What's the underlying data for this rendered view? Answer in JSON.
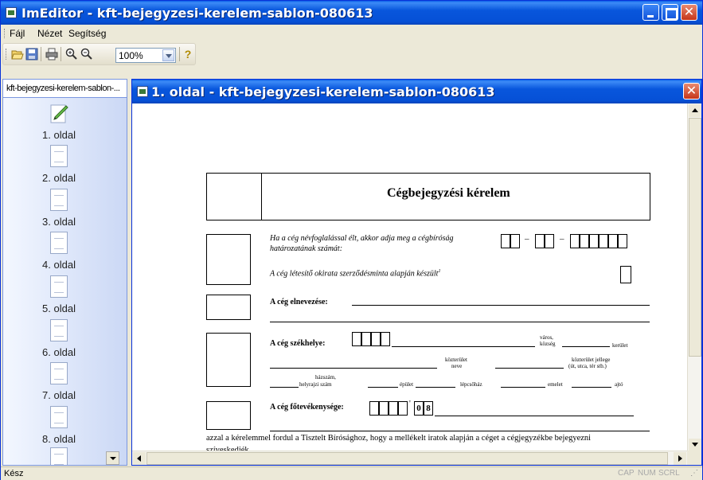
{
  "app": {
    "title": "ImEditor - kft-bejegyzesi-kerelem-sablon-080613"
  },
  "menu": [
    "Fájl",
    "Nézet",
    "Segítség"
  ],
  "toolbar": {
    "icons": [
      "open-icon",
      "save-icon",
      "print-icon",
      "zoom-in-icon",
      "zoom-out-icon",
      "help-icon"
    ],
    "zoom": "100%"
  },
  "sidebar": {
    "header": "kft-bejegyzesi-kerelem-sablon-...",
    "pages": [
      {
        "label": "1. oldal",
        "icon": "pencil-icon"
      },
      {
        "label": "2. oldal",
        "icon": "page-icon"
      },
      {
        "label": "3. oldal",
        "icon": "page-icon"
      },
      {
        "label": "4. oldal",
        "icon": "page-icon"
      },
      {
        "label": "5. oldal",
        "icon": "page-icon"
      },
      {
        "label": "6. oldal",
        "icon": "page-icon"
      },
      {
        "label": "7. oldal",
        "icon": "page-icon"
      },
      {
        "label": "8. oldal",
        "icon": "page-icon"
      }
    ]
  },
  "child": {
    "title": "1. oldal - kft-bejegyzesi-kerelem-sablon-080613"
  },
  "doc": {
    "heading": "Cégbejegyzési kérelem",
    "q1_line1": "Ha a cég névfoglalással élt, akkor adja meg a cégbíróság",
    "q1_line2": "határozatának számát:",
    "q2": "A cég létesítő okirata szerződésminta alapján készült",
    "q2_sup": "1",
    "name_label": "A cég elnevezése:",
    "seat_label": "A cég székhelye:",
    "varos": "város,",
    "kozseg": "község",
    "kerulet": "kerület",
    "kozterulet": "közterület",
    "neve": "neve",
    "kozterulet_jellege": "közterület jellege",
    "jellege_pelda": "(út, utca, tér stb.)",
    "hazszam": "házszám,",
    "helyrajzi": "helyrajzi szám",
    "epulet": "épület",
    "lepcsohaz": "lépcsőház",
    "emelet": "emelet",
    "ajto": "ajtó",
    "activity_label": "A cég főtevékenysége:",
    "activity_code_a": "0",
    "activity_code_b": "8",
    "bottom_line": "azzal a kérelemmel fordul a Tisztelt Bírósághoz, hogy a mellékelt iratok alapján a céget a cégjegyzékbe bejegyezni",
    "bottom_line2": "szíveskedjék"
  },
  "status": {
    "text": "Kész",
    "indicators": [
      "CAP",
      "NUM",
      "SCRL"
    ]
  }
}
